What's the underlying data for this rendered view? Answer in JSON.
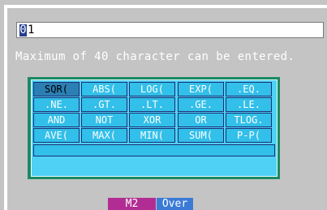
{
  "input": {
    "cursor_char": "0",
    "text": "1"
  },
  "hint": "Maximum of 40 character can be entered.",
  "keypad": {
    "rows": [
      [
        "SQR(",
        "ABS(",
        "LOG(",
        "EXP(",
        ".EQ."
      ],
      [
        ".NE.",
        ".GT.",
        ".LT.",
        ".GE.",
        ".LE."
      ],
      [
        "AND",
        "NOT",
        "XOR",
        "OR",
        "TLOG."
      ],
      [
        "AVE(",
        "MAX(",
        "MIN(",
        "SUM(",
        "P-P("
      ]
    ],
    "selected": "SQR("
  },
  "status": {
    "mode": "M2",
    "overwrite": "Over"
  },
  "colors": {
    "background": "#c4c4c4",
    "keypad": "#32bfe9",
    "selected_key": "#2c7fb4",
    "mode_tab": "#b12d94",
    "over_tab": "#3b7bd6"
  }
}
